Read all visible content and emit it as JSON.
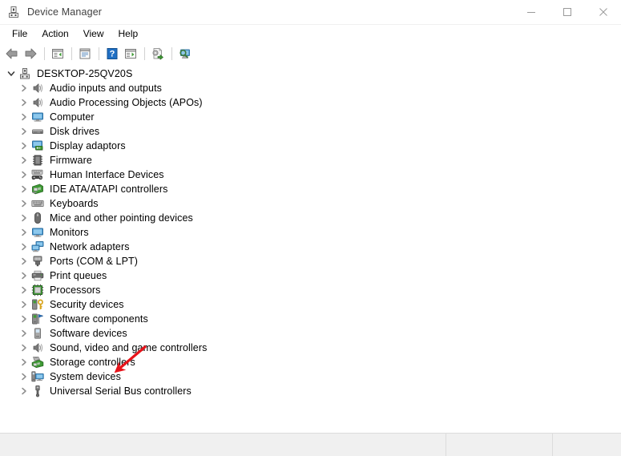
{
  "window": {
    "title": "Device Manager",
    "icon": "device-manager-icon",
    "controls": {
      "minimize": "Minimize",
      "maximize": "Maximize",
      "close": "Close"
    }
  },
  "menubar": {
    "items": [
      {
        "label": "File"
      },
      {
        "label": "Action"
      },
      {
        "label": "View"
      },
      {
        "label": "Help"
      }
    ]
  },
  "toolbar": {
    "buttons": [
      {
        "name": "back-button",
        "icon": "back-arrow-icon",
        "label": "Back"
      },
      {
        "name": "forward-button",
        "icon": "forward-arrow-icon",
        "label": "Forward"
      },
      {
        "name": "show-hide-console-tree-button",
        "icon": "console-tree-icon",
        "label": "Show/Hide Console Tree"
      },
      {
        "name": "properties-button",
        "icon": "properties-icon",
        "label": "Properties"
      },
      {
        "name": "help-button",
        "icon": "help-question-icon",
        "label": "Help"
      },
      {
        "name": "show-hide-action-pane-button",
        "icon": "action-pane-icon",
        "label": "Show/Hide Action Pane"
      },
      {
        "name": "update-driver-button",
        "icon": "update-driver-icon",
        "label": "Update Driver Software"
      },
      {
        "name": "scan-hardware-changes-button",
        "icon": "scan-hardware-icon",
        "label": "Scan for hardware changes"
      }
    ]
  },
  "tree": {
    "root": {
      "label": "DESKTOP-25QV20S",
      "icon": "computer-root-icon",
      "expanded": true
    },
    "nodes": [
      {
        "label": "Audio inputs and outputs",
        "icon": "speaker-icon",
        "expanded": false
      },
      {
        "label": "Audio Processing Objects (APOs)",
        "icon": "speaker-icon",
        "expanded": false
      },
      {
        "label": "Computer",
        "icon": "monitor-icon",
        "expanded": false
      },
      {
        "label": "Disk drives",
        "icon": "disk-drive-icon",
        "expanded": false
      },
      {
        "label": "Display adaptors",
        "icon": "display-adapter-icon",
        "expanded": false
      },
      {
        "label": "Firmware",
        "icon": "firmware-chip-icon",
        "expanded": false
      },
      {
        "label": "Human Interface Devices",
        "icon": "hid-keyboard-gamepad-icon",
        "expanded": false
      },
      {
        "label": "IDE ATA/ATAPI controllers",
        "icon": "ide-controller-icon",
        "expanded": false
      },
      {
        "label": "Keyboards",
        "icon": "keyboard-icon",
        "expanded": false
      },
      {
        "label": "Mice and other pointing devices",
        "icon": "mouse-icon",
        "expanded": false
      },
      {
        "label": "Monitors",
        "icon": "monitor-icon",
        "expanded": false
      },
      {
        "label": "Network adapters",
        "icon": "network-adapter-icon",
        "expanded": false
      },
      {
        "label": "Ports (COM & LPT)",
        "icon": "port-connector-icon",
        "expanded": false
      },
      {
        "label": "Print queues",
        "icon": "printer-icon",
        "expanded": false
      },
      {
        "label": "Processors",
        "icon": "processor-chip-icon",
        "expanded": false
      },
      {
        "label": "Security devices",
        "icon": "security-device-key-icon",
        "expanded": false
      },
      {
        "label": "Software components",
        "icon": "software-component-flag-icon",
        "expanded": false
      },
      {
        "label": "Software devices",
        "icon": "software-device-icon",
        "expanded": false
      },
      {
        "label": "Sound, video and game controllers",
        "icon": "speaker-icon",
        "expanded": false
      },
      {
        "label": "Storage controllers",
        "icon": "storage-controller-icon",
        "expanded": false
      },
      {
        "label": "System devices",
        "icon": "system-device-icon",
        "expanded": false
      },
      {
        "label": "Universal Serial Bus controllers",
        "icon": "usb-connector-icon",
        "expanded": false
      }
    ]
  },
  "annotation": {
    "type": "arrow",
    "color": "#e8131a",
    "points_to": "Security devices"
  },
  "statusbar": {
    "panes": [
      "",
      "",
      ""
    ]
  },
  "colors": {
    "window_background": "#ffffff",
    "statusbar_background": "#f0f0f0",
    "border": "#dcdcdc",
    "text": "#000000",
    "title_text": "#404040",
    "chevron": "#8d8d8d",
    "annotation_red": "#e8131a"
  }
}
